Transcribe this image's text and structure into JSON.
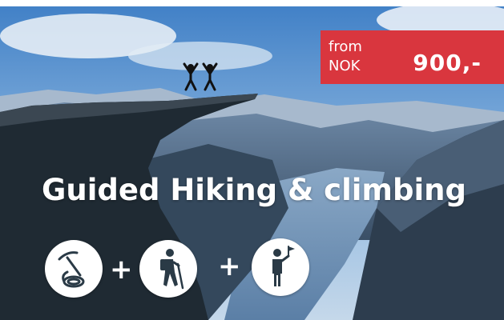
{
  "price": {
    "prefix": "from",
    "currency": "NOK",
    "amount": "900,-"
  },
  "title": "Guided Hiking & climbing",
  "icons": [
    "ice-axe-rope-icon",
    "hiker-icon",
    "guide-with-flag-icon"
  ],
  "plus_sign": "+",
  "side_caption": "",
  "colors": {
    "price_badge": "#d9363e",
    "icon_fill": "#2a3a46"
  }
}
